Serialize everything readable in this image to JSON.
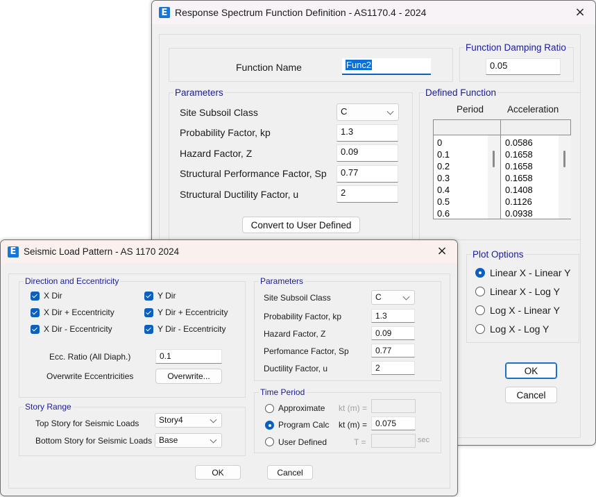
{
  "response_spectrum_window": {
    "title": "Response Spectrum Function Definition - AS1170.4 - 2024",
    "app_icon": "E",
    "function_name_label": "Function Name",
    "function_name_value": "Func2",
    "damping_group": "Function Damping Ratio",
    "damping_value": "0.05",
    "parameters_group": "Parameters",
    "parameters": [
      {
        "label": "Site Subsoil Class",
        "value": "C",
        "type": "select"
      },
      {
        "label": "Probability Factor, kp",
        "value": "1.3",
        "type": "input"
      },
      {
        "label": "Hazard Factor, Z",
        "value": "0.09",
        "type": "input"
      },
      {
        "label": "Structural Performance Factor, Sp",
        "value": "0.77",
        "type": "input"
      },
      {
        "label": "Structural Ductility Factor, u",
        "value": "2",
        "type": "input"
      }
    ],
    "convert_button": "Convert to User Defined",
    "defined_function_group": "Defined Function",
    "col_period": "Period",
    "col_acceleration": "Acceleration",
    "periods": [
      "0",
      "0.1",
      "0.2",
      "0.3",
      "0.4",
      "0.5",
      "0.6"
    ],
    "accelerations": [
      "0.0586",
      "0.1658",
      "0.1658",
      "0.1658",
      "0.1408",
      "0.1126",
      "0.0938"
    ],
    "plot_options_group": "Plot Options",
    "plot_options": [
      {
        "label": "Linear X - Linear Y",
        "selected": true
      },
      {
        "label": "Linear X - Log Y",
        "selected": false
      },
      {
        "label": "Log X - Linear Y",
        "selected": false
      },
      {
        "label": "Log X - Log Y",
        "selected": false
      }
    ],
    "ok_button": "OK",
    "cancel_button": "Cancel",
    "close_icon": "×"
  },
  "seismic_window": {
    "title": "Seismic Load Pattern - AS 1170 2024",
    "app_icon": "E",
    "close_icon": "×",
    "direction_group": "Direction and Eccentricity",
    "directions": [
      {
        "label": "X Dir",
        "checked": true
      },
      {
        "label": "Y Dir",
        "checked": true
      },
      {
        "label": "X Dir + Eccentricity",
        "checked": true
      },
      {
        "label": "Y Dir + Eccentricity",
        "checked": true
      },
      {
        "label": "X Dir - Eccentricity",
        "checked": true
      },
      {
        "label": "Y Dir - Eccentricity",
        "checked": true
      }
    ],
    "ecc_ratio_label": "Ecc. Ratio (All Diaph.)",
    "ecc_ratio_value": "0.1",
    "overwrite_label": "Overwrite Eccentricities",
    "overwrite_button": "Overwrite...",
    "story_group": "Story Range",
    "top_story_label": "Top Story for Seismic Loads",
    "top_story_value": "Story4",
    "bottom_story_label": "Bottom Story for Seismic Loads",
    "bottom_story_value": "Base",
    "parameters_group": "Parameters",
    "parameters": [
      {
        "label": "Site Subsoil Class",
        "value": "C"
      },
      {
        "label": "Probability Factor, kp",
        "value": "1.3"
      },
      {
        "label": "Hazard Factor, Z",
        "value": "0.09"
      },
      {
        "label": "Perfomance Factor, Sp",
        "value": "0.77"
      },
      {
        "label": "Ductility Factor, u",
        "value": "2"
      }
    ],
    "time_period_group": "Time Period",
    "time_options": [
      {
        "label": "Approximate",
        "selected": false,
        "field_label": "kt (m) =",
        "value": ""
      },
      {
        "label": "Program Calc",
        "selected": true,
        "field_label": "kt (m) =",
        "value": "0.075"
      },
      {
        "label": "User Defined",
        "selected": false,
        "field_label": "T =",
        "value": "",
        "unit": "sec"
      }
    ],
    "ok_button": "OK",
    "cancel_button": "Cancel"
  }
}
